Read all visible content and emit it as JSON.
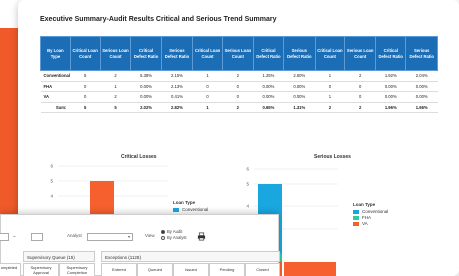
{
  "title": "Executive Summary-Audit Results Critical and Serious Trend Summary",
  "table": {
    "headers": [
      "By Loan Type",
      "Critical Loan Count",
      "Serious Loan Count",
      "Critical Defect Ratio",
      "Serious Defect Ratio",
      "Critical Loan Count",
      "Serious Loan Count",
      "Critical Defect Ratio",
      "Serious Defect Ratio",
      "Critical Loan Count",
      "Serious Loan Count",
      "Critical Defect Ratio",
      "Serious Defect Ratio"
    ],
    "rows": [
      [
        "Conventional",
        "5",
        "2",
        "5.38%",
        "2.15%",
        "1",
        "2",
        "1.25%",
        "2.50%",
        "1",
        "2",
        "1.92%",
        "2.04%"
      ],
      [
        "FHA",
        "0",
        "1",
        "0.00%",
        "2.13%",
        "0",
        "0",
        "0.00%",
        "0.00%",
        "0",
        "0",
        "0.00%",
        "0.00%"
      ],
      [
        "VA",
        "0",
        "2",
        "0.00%",
        "0.41%",
        "0",
        "0",
        "0.00%",
        "0.00%",
        "1",
        "0",
        "0.00%",
        "0.00%"
      ],
      [
        "Sum:",
        "5",
        "5",
        "2.02%",
        "2.82%",
        "1",
        "2",
        "0.65%",
        "1.31%",
        "2",
        "2",
        "1.96%",
        "1.66%"
      ]
    ]
  },
  "critical_chart": {
    "title": "Critical Losses",
    "y_ticks": [
      "6",
      "5",
      "4"
    ],
    "legend_title": "Loan Type",
    "legend_items": [
      {
        "label": "Conventional",
        "color": "#1aa7e0"
      }
    ]
  },
  "serious_chart": {
    "title": "Serious Losses",
    "y_ticks": [
      "6",
      "5",
      "4",
      "3"
    ],
    "legend_title": "Loan Type",
    "legend_items": [
      {
        "label": "Conventional",
        "color": "#1aa7e0"
      },
      {
        "label": "FHA",
        "color": "#2ecc9a"
      },
      {
        "label": "VA",
        "color": "#f5602e"
      }
    ]
  },
  "chart_data": [
    {
      "type": "bar",
      "title": "Critical Losses",
      "categories": [
        ""
      ],
      "series": [
        {
          "name": "Conventional",
          "values": [
            5
          ]
        }
      ],
      "ylim": [
        4,
        6
      ]
    },
    {
      "type": "bar",
      "title": "Serious Losses",
      "categories": [
        ""
      ],
      "series": [
        {
          "name": "Conventional",
          "values": [
            5
          ]
        },
        {
          "name": "FHA",
          "values": [
            2.3
          ]
        },
        {
          "name": "VA",
          "values": [
            2
          ]
        }
      ],
      "ylim": [
        3,
        6
      ]
    }
  ],
  "bottom": {
    "analyst_label": "Analyst",
    "view_label": "View",
    "radio_audit": "By Audit",
    "radio_analyst": "By Analyst",
    "print_icon": "printer-icon",
    "supervisory_queue": "Supervisory Queue (15)",
    "supervisory_approval": "Supervisory Approval",
    "supervisory_completion": "Supervisory Completion",
    "exceptions": "Exceptions (1128)",
    "exc_cols": [
      "Entered",
      "Queued",
      "Issued",
      "Pending",
      "Closed"
    ],
    "left_cut": "ompleted"
  },
  "colors": {
    "header_blue": "#1b6db6",
    "orange": "#f05a2a",
    "teal": "#2ecc9a",
    "cyan": "#1aa7e0"
  }
}
